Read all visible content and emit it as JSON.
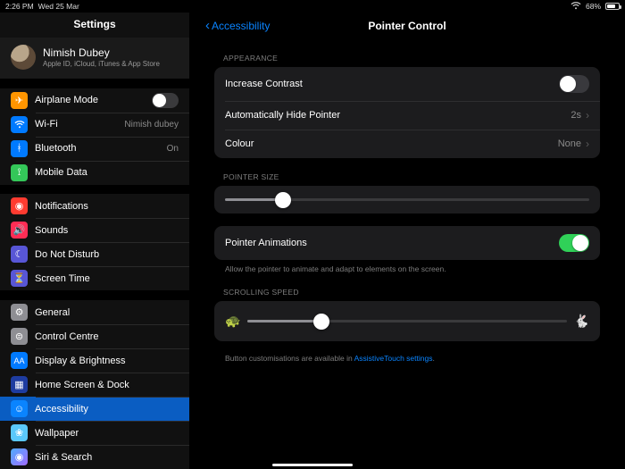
{
  "statusbar": {
    "time": "2:26 PM",
    "date": "Wed 25 Mar",
    "battery_pct": "68%"
  },
  "sidebar": {
    "title": "Settings",
    "profile": {
      "name": "Nimish Dubey",
      "sub": "Apple ID, iCloud, iTunes & App Store"
    },
    "g1": {
      "airplane": "Airplane Mode",
      "wifi": "Wi-Fi",
      "wifi_val": "Nimish dubey",
      "bt": "Bluetooth",
      "bt_val": "On",
      "mobile": "Mobile Data"
    },
    "g2": {
      "notif": "Notifications",
      "sounds": "Sounds",
      "dnd": "Do Not Disturb",
      "screentime": "Screen Time"
    },
    "g3": {
      "general": "General",
      "cc": "Control Centre",
      "display": "Display & Brightness",
      "home": "Home Screen & Dock",
      "access": "Accessibility",
      "wallpaper": "Wallpaper",
      "siri": "Siri & Search"
    }
  },
  "detail": {
    "back": "Accessibility",
    "title": "Pointer Control",
    "appearance_label": "APPEARANCE",
    "increase_contrast": "Increase Contrast",
    "auto_hide": "Automatically Hide Pointer",
    "auto_hide_val": "2s",
    "colour": "Colour",
    "colour_val": "None",
    "pointer_size_label": "POINTER SIZE",
    "pointer_size_pct": 16,
    "anim_label": "Pointer Animations",
    "anim_note": "Allow the pointer to animate and adapt to elements on the screen.",
    "scroll_label": "SCROLLING SPEED",
    "scroll_pct": 23,
    "custom_note_a": "Button customisations are available in ",
    "custom_link": "AssistiveTouch settings",
    "custom_note_b": "."
  }
}
